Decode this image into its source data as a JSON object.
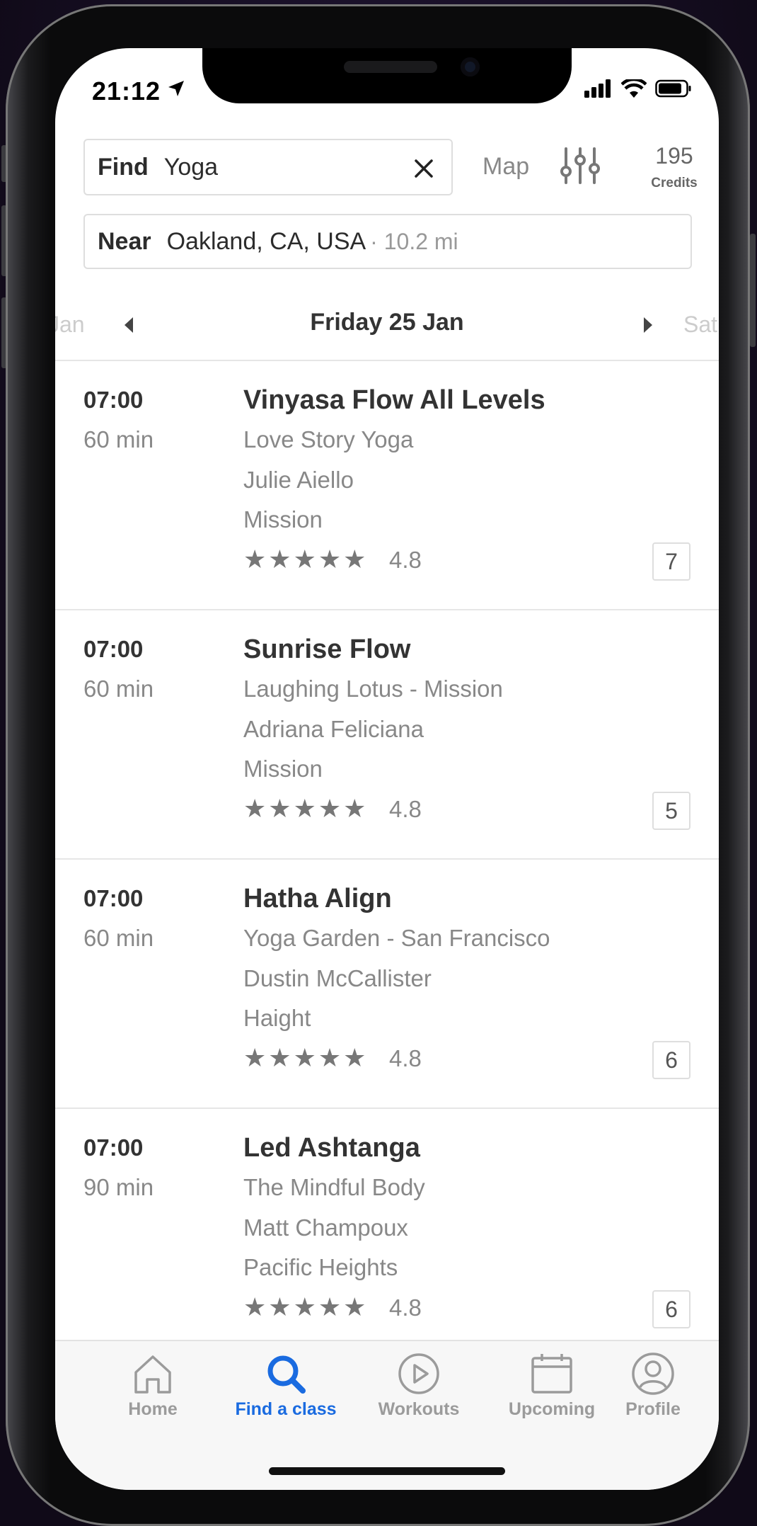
{
  "status": {
    "time": "21:12"
  },
  "search": {
    "find_label": "Find",
    "find_value": "Yoga",
    "map_label": "Map",
    "credits_count": "195",
    "credits_label": "Credits",
    "near_label": "Near",
    "near_value": "Oakland, CA, USA",
    "near_distance": "· 10.2 mi"
  },
  "date_nav": {
    "prev_label": "Jan",
    "current": "Friday 25 Jan",
    "next_label": "Sat"
  },
  "classes": [
    {
      "time": "07:00",
      "duration": "60 min",
      "title": "Vinyasa Flow All Levels",
      "studio": "Love Story Yoga",
      "instructor": "Julie Aiello",
      "neighborhood": "Mission",
      "rating": "4.8",
      "spots": "7"
    },
    {
      "time": "07:00",
      "duration": "60 min",
      "title": "Sunrise Flow",
      "studio": "Laughing Lotus - Mission",
      "instructor": "Adriana Feliciana",
      "neighborhood": "Mission",
      "rating": "4.8",
      "spots": "5"
    },
    {
      "time": "07:00",
      "duration": "60 min",
      "title": "Hatha Align",
      "studio": "Yoga Garden - San Francisco",
      "instructor": "Dustin McCallister",
      "neighborhood": "Haight",
      "rating": "4.8",
      "spots": "6"
    },
    {
      "time": "07:00",
      "duration": "90 min",
      "title": "Led Ashtanga",
      "studio": "The Mindful Body",
      "instructor": "Matt Champoux",
      "neighborhood": "Pacific Heights",
      "rating": "4.8",
      "spots": "6"
    }
  ],
  "tabs": [
    {
      "label": "Home",
      "icon": "home-icon"
    },
    {
      "label": "Find a class",
      "icon": "search-icon",
      "active": true
    },
    {
      "label": "Workouts",
      "icon": "play-icon"
    },
    {
      "label": "Upcoming",
      "icon": "calendar-icon"
    },
    {
      "label": "Profile",
      "icon": "profile-icon"
    }
  ],
  "colors": {
    "accent": "#1a6be0",
    "text": "#333333",
    "muted": "#888888"
  }
}
